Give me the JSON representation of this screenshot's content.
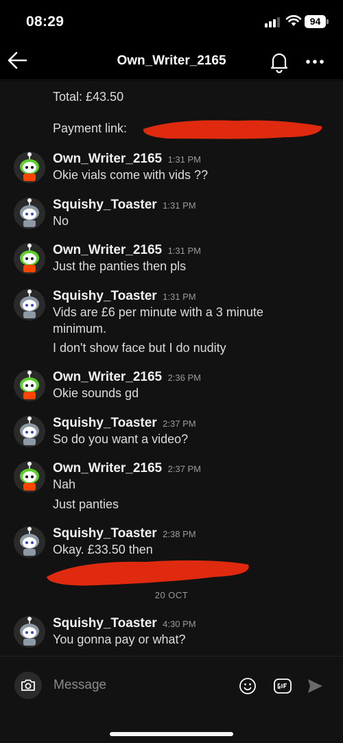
{
  "status_bar": {
    "time": "08:29",
    "battery": "94"
  },
  "header": {
    "title": "Own_Writer_2165"
  },
  "top_info": {
    "total": "Total: £43.50",
    "payment_link_label": "Payment link:"
  },
  "messages": [
    {
      "username": "Own_Writer_2165",
      "time": "1:31 PM",
      "lines": [
        "Okie vials come with vids ??"
      ]
    },
    {
      "username": "Squishy_Toaster",
      "time": "1:31 PM",
      "lines": [
        "No"
      ]
    },
    {
      "username": "Own_Writer_2165",
      "time": "1:31 PM",
      "lines": [
        "Just the panties then pls"
      ]
    },
    {
      "username": "Squishy_Toaster",
      "time": "1:31 PM",
      "lines": [
        "Vids are £6 per minute with a 3 minute",
        "minimum.",
        "I don't show face but I do nudity"
      ]
    },
    {
      "username": "Own_Writer_2165",
      "time": "2:36 PM",
      "lines": [
        "Okie sounds gd"
      ]
    },
    {
      "username": "Squishy_Toaster",
      "time": "2:37 PM",
      "lines": [
        "So do you want a video?"
      ]
    },
    {
      "username": "Own_Writer_2165",
      "time": "2:37 PM",
      "lines": [
        "Nah",
        "Just panties"
      ]
    },
    {
      "username": "Squishy_Toaster",
      "time": "2:38 PM",
      "lines": [
        "Okay. £33.50 then"
      ]
    },
    {
      "username": "Squishy_Toaster",
      "time": "4:30 PM",
      "lines": [
        "You gonna pay or what?"
      ]
    }
  ],
  "date_divider": "20 OCT",
  "composer": {
    "placeholder": "Message"
  },
  "colors": {
    "redaction": "#e02a0f",
    "background": "#121212",
    "avatar_green": "#5bd02a",
    "avatar_orange": "#ff4500"
  },
  "icons": [
    "back-arrow-icon",
    "bell-icon",
    "more-dots-icon",
    "camera-icon",
    "emoji-icon",
    "gif-icon",
    "send-icon"
  ]
}
